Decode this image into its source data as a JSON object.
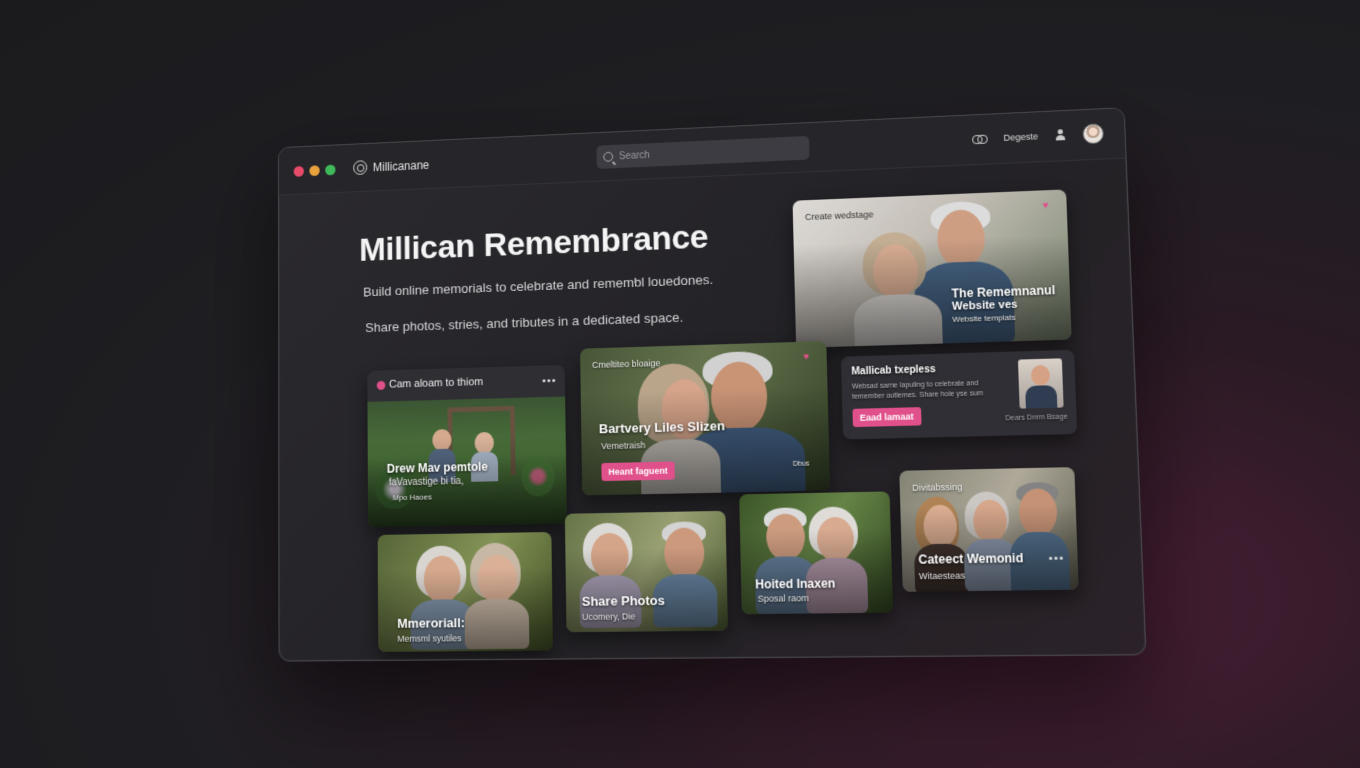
{
  "window": {
    "brand_name": "Millicanane",
    "search_placeholder": "Search",
    "nav_label": "Degeste"
  },
  "hero": {
    "title": "Millican Remembrance",
    "subtitle": "Build online memorials to celebrate and remembl louedones.",
    "subtitle2": "Share photos, stries, and tributes in a dedicated space."
  },
  "cards": {
    "featured": {
      "tag": "Create wedstage",
      "title": "The Rememnanul",
      "title2": "Website ves",
      "sub": "Website templats"
    },
    "info": {
      "title": "Mallicab txepless",
      "body": "Websad sarne lapuling to celebrate and temember outlemes. Share hole yse sum",
      "button": "Eaad lamaat",
      "footnote": "Dears Dnrm Bsage"
    },
    "garden": {
      "header": "Cam aloam to thiom",
      "title": "Drew Mav pemtole",
      "sub": "faVavastige bi tia,",
      "sub2": "Mpo Haoes"
    },
    "couple": {
      "tag": "Cmeltiteo bloaige",
      "title": "Bartvery Liles Slizen",
      "sub": "Vemetraish",
      "button": "Heant faguent",
      "meta": "Dbus"
    },
    "tile1": {
      "title": "Mmeroriall:",
      "sub": "Memsml syutiles"
    },
    "tile2": {
      "title": "Share Photos",
      "sub": "Ucomery, Die"
    },
    "tile3": {
      "title": "Hoited Inaxen",
      "sub": "Sposal raom"
    },
    "tile4": {
      "tag": "Divitabssing",
      "title": "Cateect Wemonid",
      "sub": "Witaesteas"
    }
  },
  "colors": {
    "accent": "#e0508a",
    "background": "#1e1e22",
    "window": "#262529"
  },
  "icons": [
    "logo-icon",
    "search-icon",
    "link-icon",
    "user-icon",
    "heart-icon",
    "more-icon"
  ]
}
